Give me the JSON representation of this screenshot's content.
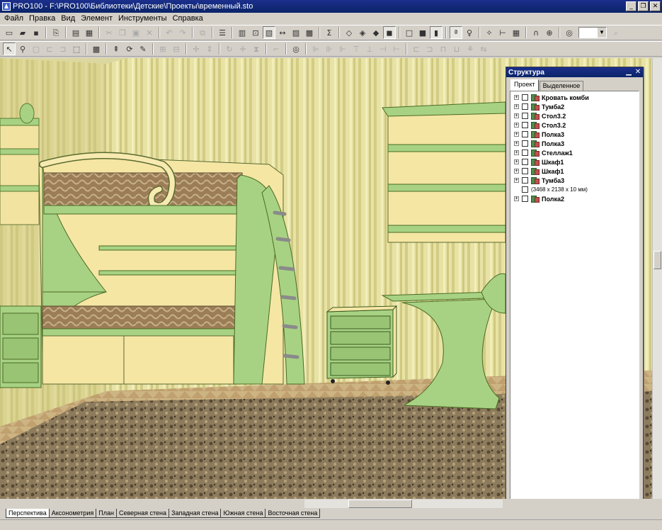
{
  "window": {
    "title": "PRO100 - F:\\PRO100\\Библиотеки\\Детские\\Проекты\\временный.sto",
    "controls": [
      "minimize",
      "restore",
      "close"
    ]
  },
  "menu": [
    "Файл",
    "Правка",
    "Вид",
    "Элемент",
    "Инструменты",
    "Справка"
  ],
  "toolbar_top": [
    {
      "icon": "new-file-icon",
      "glyph": "▭"
    },
    {
      "icon": "open-folder-icon",
      "glyph": "▰"
    },
    {
      "icon": "save-icon",
      "glyph": "▪"
    },
    {
      "sep": true
    },
    {
      "icon": "export-icon",
      "glyph": "⎘"
    },
    {
      "sep": true
    },
    {
      "icon": "print-icon",
      "glyph": "▤"
    },
    {
      "icon": "print-preview-icon",
      "glyph": "▦"
    },
    {
      "sep": true
    },
    {
      "icon": "cut-icon",
      "glyph": "✂",
      "disabled": true
    },
    {
      "icon": "copy-icon",
      "glyph": "❐",
      "disabled": true
    },
    {
      "icon": "paste-icon",
      "glyph": "▣",
      "disabled": true
    },
    {
      "icon": "delete-icon",
      "glyph": "✕",
      "disabled": true
    },
    {
      "sep": true
    },
    {
      "icon": "undo-icon",
      "glyph": "↶",
      "disabled": true
    },
    {
      "icon": "redo-icon",
      "glyph": "↷",
      "disabled": true
    },
    {
      "sep": true
    },
    {
      "icon": "group-icon",
      "glyph": "⧉",
      "disabled": true
    },
    {
      "sep": true
    },
    {
      "icon": "properties-icon",
      "glyph": "☰"
    },
    {
      "sep": true
    },
    {
      "icon": "view-library-icon",
      "glyph": "▥"
    },
    {
      "icon": "zoom-window-icon",
      "glyph": "⊡"
    },
    {
      "icon": "view-wall-icon",
      "glyph": "▧",
      "active": true
    },
    {
      "icon": "dimension-icon",
      "glyph": "↔"
    },
    {
      "icon": "edit-material-icon",
      "glyph": "▨"
    },
    {
      "icon": "texture-icon",
      "glyph": "▩"
    },
    {
      "sep": true
    },
    {
      "icon": "sum-icon",
      "glyph": "Σ"
    },
    {
      "sep": true
    },
    {
      "icon": "cube-wire-icon",
      "glyph": "◇"
    },
    {
      "icon": "cube-hidden-icon",
      "glyph": "◈"
    },
    {
      "icon": "cube-shaded-icon",
      "glyph": "◆"
    },
    {
      "icon": "cube-textured-icon",
      "glyph": "◼",
      "active": true
    },
    {
      "sep": true
    },
    {
      "icon": "cube-outline-icon",
      "glyph": "□"
    },
    {
      "icon": "cube-color-icon",
      "glyph": "■"
    },
    {
      "icon": "cube-solid-icon",
      "glyph": "▮",
      "active": true
    },
    {
      "sep": true
    },
    {
      "icon": "text-label-icon",
      "glyph": "ª",
      "active": true
    },
    {
      "icon": "light-bulb-icon",
      "glyph": "♀"
    },
    {
      "sep": true
    },
    {
      "icon": "light-settings-icon",
      "glyph": "✧"
    },
    {
      "icon": "measure-icon",
      "glyph": "⊢"
    },
    {
      "icon": "grid-icon",
      "glyph": "▦"
    },
    {
      "sep": true
    },
    {
      "icon": "magnet-icon",
      "glyph": "∩"
    },
    {
      "icon": "globe-icon",
      "glyph": "⊕"
    },
    {
      "sep": true
    },
    {
      "icon": "target-icon",
      "glyph": "◎"
    },
    {
      "zoom": true
    },
    {
      "icon": "zoom-icon",
      "glyph": "⌕",
      "disabled": true
    }
  ],
  "toolbar_second": [
    {
      "icon": "select-arrow-icon",
      "glyph": "↖",
      "active": true
    },
    {
      "icon": "walk-icon",
      "glyph": "⚲"
    },
    {
      "icon": "box-disabled-icon",
      "glyph": "▢",
      "disabled": true
    },
    {
      "icon": "box-link-icon",
      "glyph": "⊏",
      "disabled": true
    },
    {
      "icon": "box-move-icon",
      "glyph": "⊐",
      "disabled": true
    },
    {
      "icon": "selection-icon",
      "glyph": "⬚"
    },
    {
      "sep": true
    },
    {
      "icon": "grid-select-icon",
      "glyph": "▩"
    },
    {
      "sep": true
    },
    {
      "icon": "lift-icon",
      "glyph": "⇞"
    },
    {
      "icon": "rotate-3d-icon",
      "glyph": "⟳"
    },
    {
      "icon": "pencil-icon",
      "glyph": "✎"
    },
    {
      "sep": true
    },
    {
      "icon": "frame-icon",
      "glyph": "⊞",
      "disabled": true
    },
    {
      "icon": "frame-2-icon",
      "glyph": "⊟",
      "disabled": true
    },
    {
      "sep": true
    },
    {
      "icon": "pivot-icon",
      "glyph": "✢",
      "disabled": true
    },
    {
      "icon": "move-icon",
      "glyph": "⇕",
      "disabled": true
    },
    {
      "sep": true
    },
    {
      "icon": "rotate-icon",
      "glyph": "↻",
      "disabled": true
    },
    {
      "icon": "move-cross-icon",
      "glyph": "✛",
      "disabled": true
    },
    {
      "icon": "mirror-icon",
      "glyph": "⧗",
      "disabled": true
    },
    {
      "sep": true
    },
    {
      "icon": "corner-icon",
      "glyph": "⌐",
      "disabled": true
    },
    {
      "sep": true
    },
    {
      "icon": "target-red-icon",
      "glyph": "◎"
    },
    {
      "sep": true
    },
    {
      "icon": "align-left-icon",
      "glyph": "⊫",
      "disabled": true
    },
    {
      "icon": "align-center-icon",
      "glyph": "⊪",
      "disabled": true
    },
    {
      "icon": "align-right-icon",
      "glyph": "⊩",
      "disabled": true
    },
    {
      "icon": "align-top-icon",
      "glyph": "⊤",
      "disabled": true
    },
    {
      "icon": "align-middle-icon",
      "glyph": "⊥",
      "disabled": true
    },
    {
      "icon": "align-bottom-icon",
      "glyph": "⊣",
      "disabled": true
    },
    {
      "icon": "distribute-icon",
      "glyph": "⊢",
      "disabled": true
    },
    {
      "sep": true
    },
    {
      "icon": "join-icon",
      "glyph": "⊏",
      "disabled": true
    },
    {
      "icon": "join-2-icon",
      "glyph": "⊐",
      "disabled": true
    },
    {
      "icon": "split-icon",
      "glyph": "⊓",
      "disabled": true
    },
    {
      "icon": "split-2-icon",
      "glyph": "⊔",
      "disabled": true
    },
    {
      "icon": "brush-icon",
      "glyph": "⚘",
      "disabled": true
    },
    {
      "icon": "arrange-icon",
      "glyph": "⇆",
      "disabled": true
    }
  ],
  "zoom": {
    "value": ""
  },
  "structure_panel": {
    "title": "Структура",
    "tabs": [
      "Проект",
      "Выделенное"
    ],
    "items": [
      {
        "label": "Кровать комби",
        "expandable": true
      },
      {
        "label": "Тумба2",
        "expandable": true
      },
      {
        "label": "Стол3.2",
        "expandable": true
      },
      {
        "label": "Стол3.2",
        "expandable": true
      },
      {
        "label": "Полка3",
        "expandable": true
      },
      {
        "label": "Полка3",
        "expandable": true
      },
      {
        "label": "Стеллаж1",
        "expandable": true
      },
      {
        "label": "Шкаф1",
        "expandable": true
      },
      {
        "label": "Шкаф1",
        "expandable": true
      },
      {
        "label": "Тумба3",
        "expandable": true
      },
      {
        "label": "(3468 x 2138 x 10 мм)",
        "expandable": false,
        "plain": true
      },
      {
        "label": "Полка2",
        "expandable": true
      }
    ]
  },
  "view_tabs": [
    "Перспектива",
    "Аксонометрия",
    "План",
    "Северная стена",
    "Западная стена",
    "Южная стена",
    "Восточная стена"
  ],
  "active_view_tab": 0,
  "colors": {
    "curtain": "#e6e1a1",
    "curtain_dark": "#c9c47a",
    "furniture_green": "#a8d283",
    "furniture_cream": "#f5e6a4",
    "floor": "#c9b07e",
    "carpet": "#8a7a5a",
    "title_blue": "#0a2468"
  }
}
